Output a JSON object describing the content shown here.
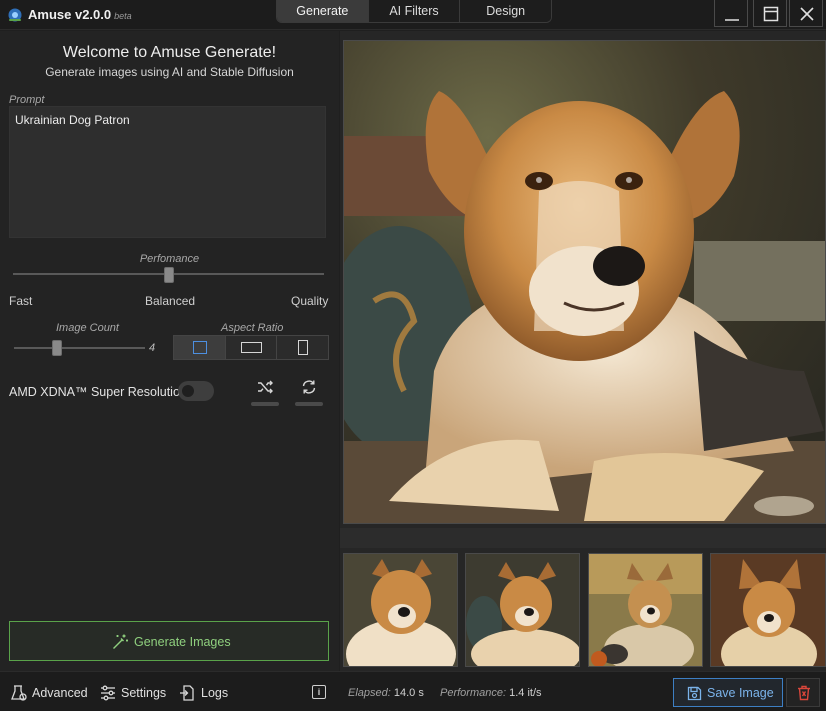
{
  "app": {
    "name": "Amuse v2.0.0",
    "badge": "beta"
  },
  "tabs": [
    {
      "label": "Generate",
      "active": true
    },
    {
      "label": "AI Filters",
      "active": false
    },
    {
      "label": "Design",
      "active": false
    }
  ],
  "left": {
    "welcome": "Welcome to Amuse Generate!",
    "subtitle": "Generate images using AI and Stable Diffusion",
    "prompt_label": "Prompt",
    "prompt_value": "Ukrainian Dog Patron",
    "performance": {
      "label": "Perfomance",
      "ticks": [
        "Fast",
        "Balanced",
        "Quality"
      ],
      "value_fraction": 0.5
    },
    "image_count": {
      "label": "Image Count",
      "value": "4",
      "value_fraction": 0.32
    },
    "aspect_ratio": {
      "label": "Aspect Ratio",
      "selected": "square",
      "options": [
        "square",
        "landscape",
        "portrait"
      ]
    },
    "super_resolution": {
      "label": "AMD XDNA™ Super Resolution",
      "enabled": false
    },
    "generate_button": "Generate Images"
  },
  "status": {
    "advanced": "Advanced",
    "settings": "Settings",
    "logs": "Logs",
    "info_icon": "i",
    "elapsed_label": "Elapsed:",
    "elapsed_value": "14.0 s",
    "perf_label": "Performance:",
    "perf_value": "1.4 it/s",
    "save_button": "Save Image"
  },
  "colors": {
    "accent_green": "#5aa34a",
    "accent_blue": "#3d7fc4",
    "delete_red": "#d9463b"
  }
}
